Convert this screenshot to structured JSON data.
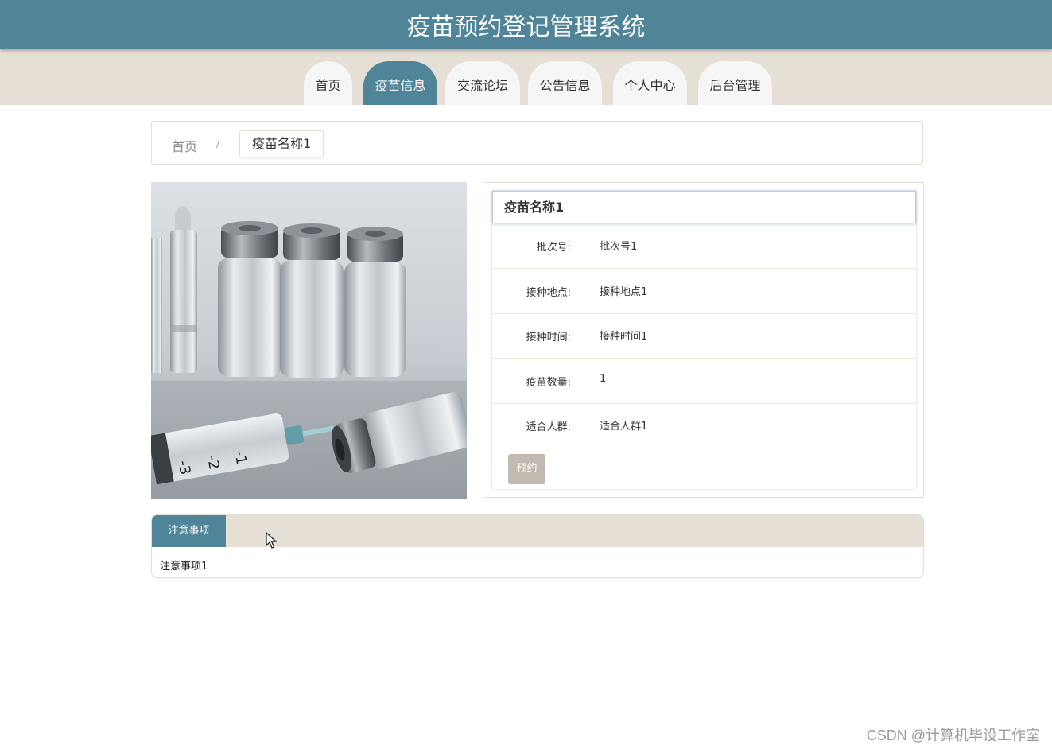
{
  "header": {
    "title": "疫苗预约登记管理系统"
  },
  "nav": {
    "items": [
      {
        "label": "首页"
      },
      {
        "label": "疫苗信息"
      },
      {
        "label": "交流论坛"
      },
      {
        "label": "公告信息"
      },
      {
        "label": "个人中心"
      },
      {
        "label": "后台管理"
      }
    ],
    "active_index": 1
  },
  "breadcrumb": {
    "home": "首页",
    "separator": "/",
    "current": "疫苗名称1"
  },
  "detail": {
    "title": "疫苗名称1",
    "rows": [
      {
        "label": "批次号:",
        "value": "批次号1"
      },
      {
        "label": "接种地点:",
        "value": "接种地点1"
      },
      {
        "label": "接种时间:",
        "value": "接种时间1"
      },
      {
        "label": "疫苗数量:",
        "value": "1"
      },
      {
        "label": "适合人群:",
        "value": "适合人群1"
      }
    ],
    "reserve_button": "预约"
  },
  "notes": {
    "tab_label": "注意事项",
    "content": "注意事项1"
  },
  "watermark": "CSDN @计算机毕设工作室",
  "colors": {
    "primary": "#4f8499",
    "nav_background": "#e6dfd5",
    "button_disabled": "#c2bab0"
  }
}
